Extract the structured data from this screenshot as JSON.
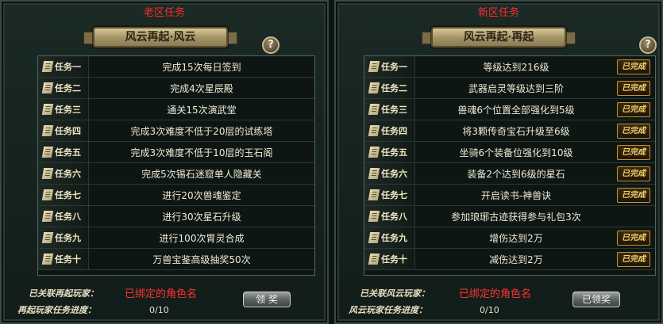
{
  "left": {
    "region_label": "老区任务",
    "banner": "风云再起·风云",
    "help": "?",
    "tasks": [
      {
        "tag": "任务一",
        "desc": "完成15次每日签到"
      },
      {
        "tag": "任务二",
        "desc": "完成4次星辰殿"
      },
      {
        "tag": "任务三",
        "desc": "通关15次演武堂"
      },
      {
        "tag": "任务四",
        "desc": "完成3次难度不低于20层的试练塔"
      },
      {
        "tag": "任务五",
        "desc": "完成3次难度不低于10层的玉石阁"
      },
      {
        "tag": "任务六",
        "desc": "完成5次锡石迷窟单人隐藏关"
      },
      {
        "tag": "任务七",
        "desc": "进行20次兽魂鉴定"
      },
      {
        "tag": "任务八",
        "desc": "进行30次星石升级"
      },
      {
        "tag": "任务九",
        "desc": "进行100次胃灵合成"
      },
      {
        "tag": "任务十",
        "desc": "万兽宝鉴高级抽奖50次"
      }
    ],
    "linked_label": "已关联再起玩家：",
    "linked_value": "已绑定的角色名",
    "progress_label": "再起玩家任务进度：",
    "progress_value": "0/10",
    "claim_button": "领 奖"
  },
  "right": {
    "region_label": "新区任务",
    "banner": "风云再起·再起",
    "help": "?",
    "tasks": [
      {
        "tag": "任务一",
        "desc": "等级达到216级",
        "done": true
      },
      {
        "tag": "任务二",
        "desc": "武器启灵等级达到三阶",
        "done": true
      },
      {
        "tag": "任务三",
        "desc": "兽魂6个位置全部强化到5级",
        "done": true
      },
      {
        "tag": "任务四",
        "desc": "将3颗传奇宝石升级至6级",
        "done": true
      },
      {
        "tag": "任务五",
        "desc": "坐骑6个装备位强化到10级",
        "done": true
      },
      {
        "tag": "任务六",
        "desc": "装备2个达到6级的星石",
        "done": true
      },
      {
        "tag": "任务七",
        "desc": "开启读书-神兽诀",
        "done": true
      },
      {
        "tag": "任务八",
        "desc": "参加琅琊古迹获得参与礼包3次",
        "done": false
      },
      {
        "tag": "任务九",
        "desc": "增伤达到2万",
        "done": true
      },
      {
        "tag": "任务十",
        "desc": "减伤达到2万",
        "done": true
      }
    ],
    "done_label": "已完成",
    "linked_label": "已关联风云玩家：",
    "linked_value": "已绑定的角色名",
    "progress_label": "风云玩家任务进度：",
    "progress_value": "0/10",
    "claim_button": "已领奖"
  }
}
